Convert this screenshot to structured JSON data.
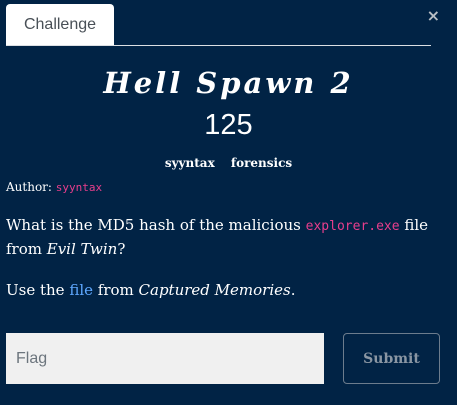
{
  "tabs": [
    {
      "label": "Challenge"
    }
  ],
  "close_icon": "×",
  "challenge": {
    "name": "Hell Spawn 2",
    "value": "125",
    "tags": [
      "syyntax",
      "forensics"
    ],
    "author_label": "Author:",
    "author": "syyntax",
    "description": {
      "part1": "What is the MD5 hash of the malicious ",
      "code": "explorer.exe",
      "part2": " file from ",
      "em": "Evil Twin",
      "part3": "?"
    },
    "hint": {
      "part1": "Use the ",
      "link": "file",
      "part2": " from ",
      "em": "Captured Memories",
      "part3": "."
    }
  },
  "form": {
    "flag_placeholder": "Flag",
    "submit_label": "Submit"
  },
  "colors": {
    "background": "#012345",
    "code": "#e83e8c",
    "link": "#5fa8ff"
  }
}
